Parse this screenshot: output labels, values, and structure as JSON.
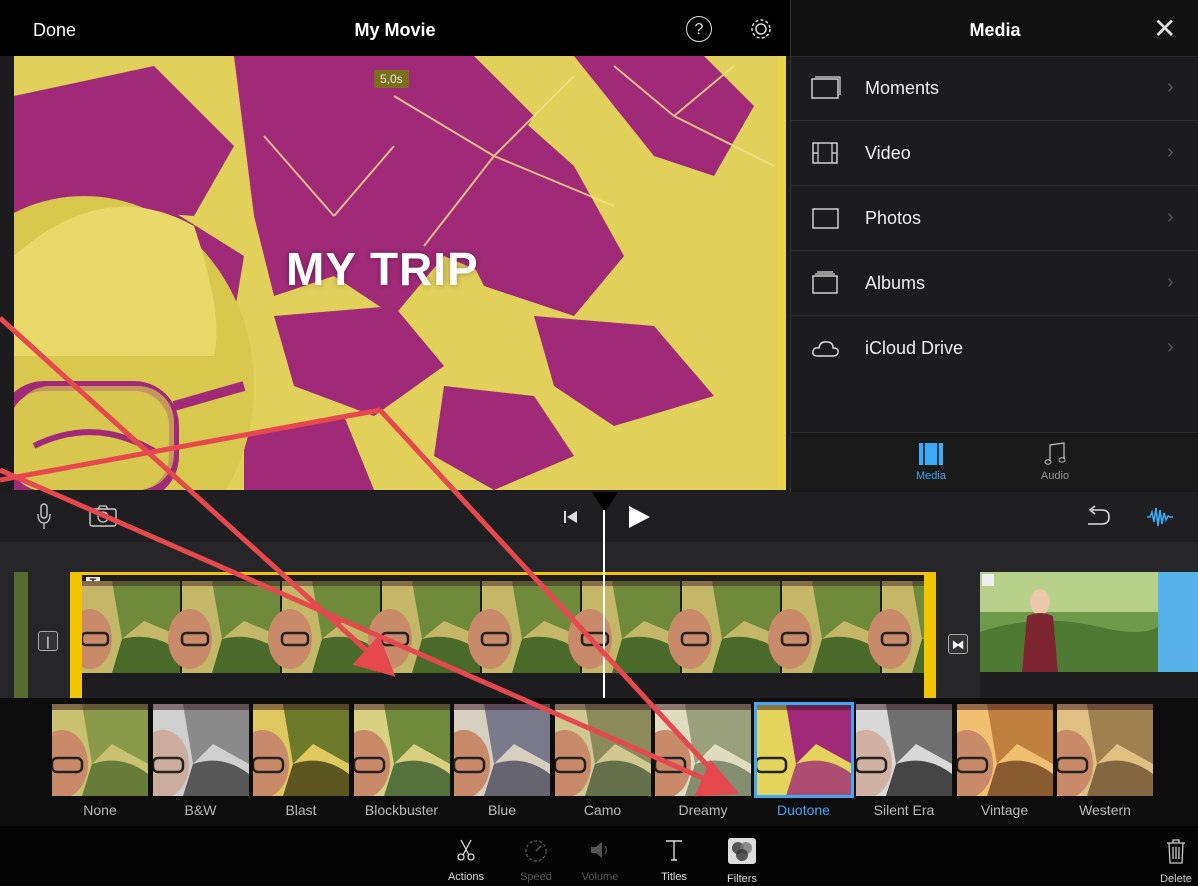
{
  "header": {
    "done_label": "Done",
    "title": "My Movie",
    "help_glyph": "?"
  },
  "viewer": {
    "duration": "5,0s",
    "movie_title": "MY TRIP"
  },
  "media_panel": {
    "title": "Media",
    "close_glyph": "✕",
    "items": [
      {
        "label": "Moments",
        "icon": "moments-icon"
      },
      {
        "label": "Video",
        "icon": "film-icon"
      },
      {
        "label": "Photos",
        "icon": "photo-icon"
      },
      {
        "label": "Albums",
        "icon": "albums-icon"
      },
      {
        "label": "iCloud Drive",
        "icon": "cloud-icon"
      }
    ],
    "tabs": [
      {
        "label": "Media",
        "active": true
      },
      {
        "label": "Audio",
        "active": false
      }
    ],
    "chevron": "›"
  },
  "filters": {
    "items": [
      "None",
      "B&W",
      "Blast",
      "Blockbuster",
      "Blue",
      "Camo",
      "Dreamy",
      "Duotone",
      "Silent Era",
      "Vintage",
      "Western"
    ],
    "selected": "Duotone"
  },
  "toolbar": {
    "tools": [
      {
        "label": "Actions",
        "active": false
      },
      {
        "label": "Speed",
        "active": false,
        "disabled": true
      },
      {
        "label": "Volume",
        "active": false,
        "disabled": true
      },
      {
        "label": "Titles",
        "active": false
      },
      {
        "label": "Filters",
        "active": true
      }
    ],
    "delete_label": "Delete"
  },
  "colors": {
    "accent": "#3fa9f5",
    "clip_border": "#f3c400",
    "arrow": "#e5484d",
    "duotone_yellow": "#e4d45c",
    "duotone_magenta": "#a02a78"
  }
}
